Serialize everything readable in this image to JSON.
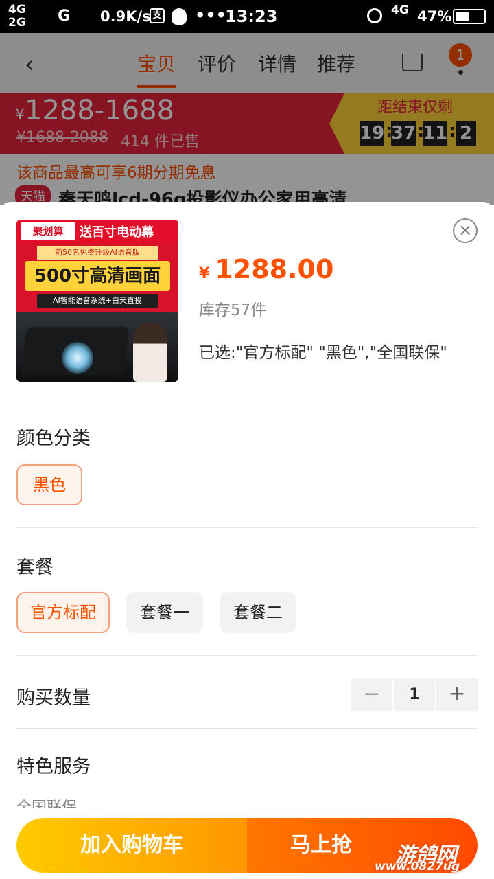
{
  "status_bar": {
    "network_line1": "4G",
    "network_line2": "2G",
    "carrier": "G",
    "speed": "0.9K/s",
    "icon_app": "支",
    "dots": "•••",
    "time": "13:23",
    "network_right": "4G",
    "battery_text": "47%",
    "battery_level": 0.47
  },
  "background": {
    "nav": {
      "back": "‹",
      "tabs": [
        "宝贝",
        "评价",
        "详情",
        "推荐"
      ],
      "active_tab": "宝贝",
      "badge": "1"
    },
    "promo": {
      "currency": "¥",
      "price_range": "1288-1688",
      "original_price": "¥1688-2088",
      "sold": "414 件已售",
      "ends_label": "距结束仅剩",
      "countdown": [
        "19",
        "37",
        "11",
        "2"
      ]
    },
    "installment_note": "该商品最高可享6期分期免息",
    "tag": "天猫",
    "title": "秦天鸣lcd-96g投影仪办公家用高清"
  },
  "sheet": {
    "thumbnail": {
      "logo": "聚划算",
      "gift": "送百寸电动幕",
      "sub": "前50名免费升级AI语音版",
      "headline": "500寸高清画面",
      "ai_line": "AI智能语音系统+白天直投"
    },
    "close": "×",
    "currency": "¥",
    "price": "1288.00",
    "stock": "库存57件",
    "selected": "已选:\"官方标配\" \"黑色\",\"全国联保\"",
    "color_section": {
      "label": "颜色分类",
      "options": [
        {
          "label": "黑色",
          "selected": true
        }
      ]
    },
    "package_section": {
      "label": "套餐",
      "options": [
        {
          "label": "官方标配",
          "selected": true
        },
        {
          "label": "套餐一",
          "selected": false
        },
        {
          "label": "套餐二",
          "selected": false
        }
      ]
    },
    "quantity": {
      "label": "购买数量",
      "minus": "−",
      "value": "1",
      "plus": "+"
    },
    "services": {
      "label": "特色服务",
      "first_option": "全国联保"
    },
    "buttons": {
      "add_to_cart": "加入购物车",
      "buy_now": "马上抢"
    },
    "watermark": {
      "brand": "游鸽网",
      "url": "www.0827ug"
    }
  },
  "colors": {
    "accent": "#ff5000",
    "promo_red": "#e8233c",
    "cart_button": "#ffb300",
    "buy_button": "#ff5a00"
  }
}
